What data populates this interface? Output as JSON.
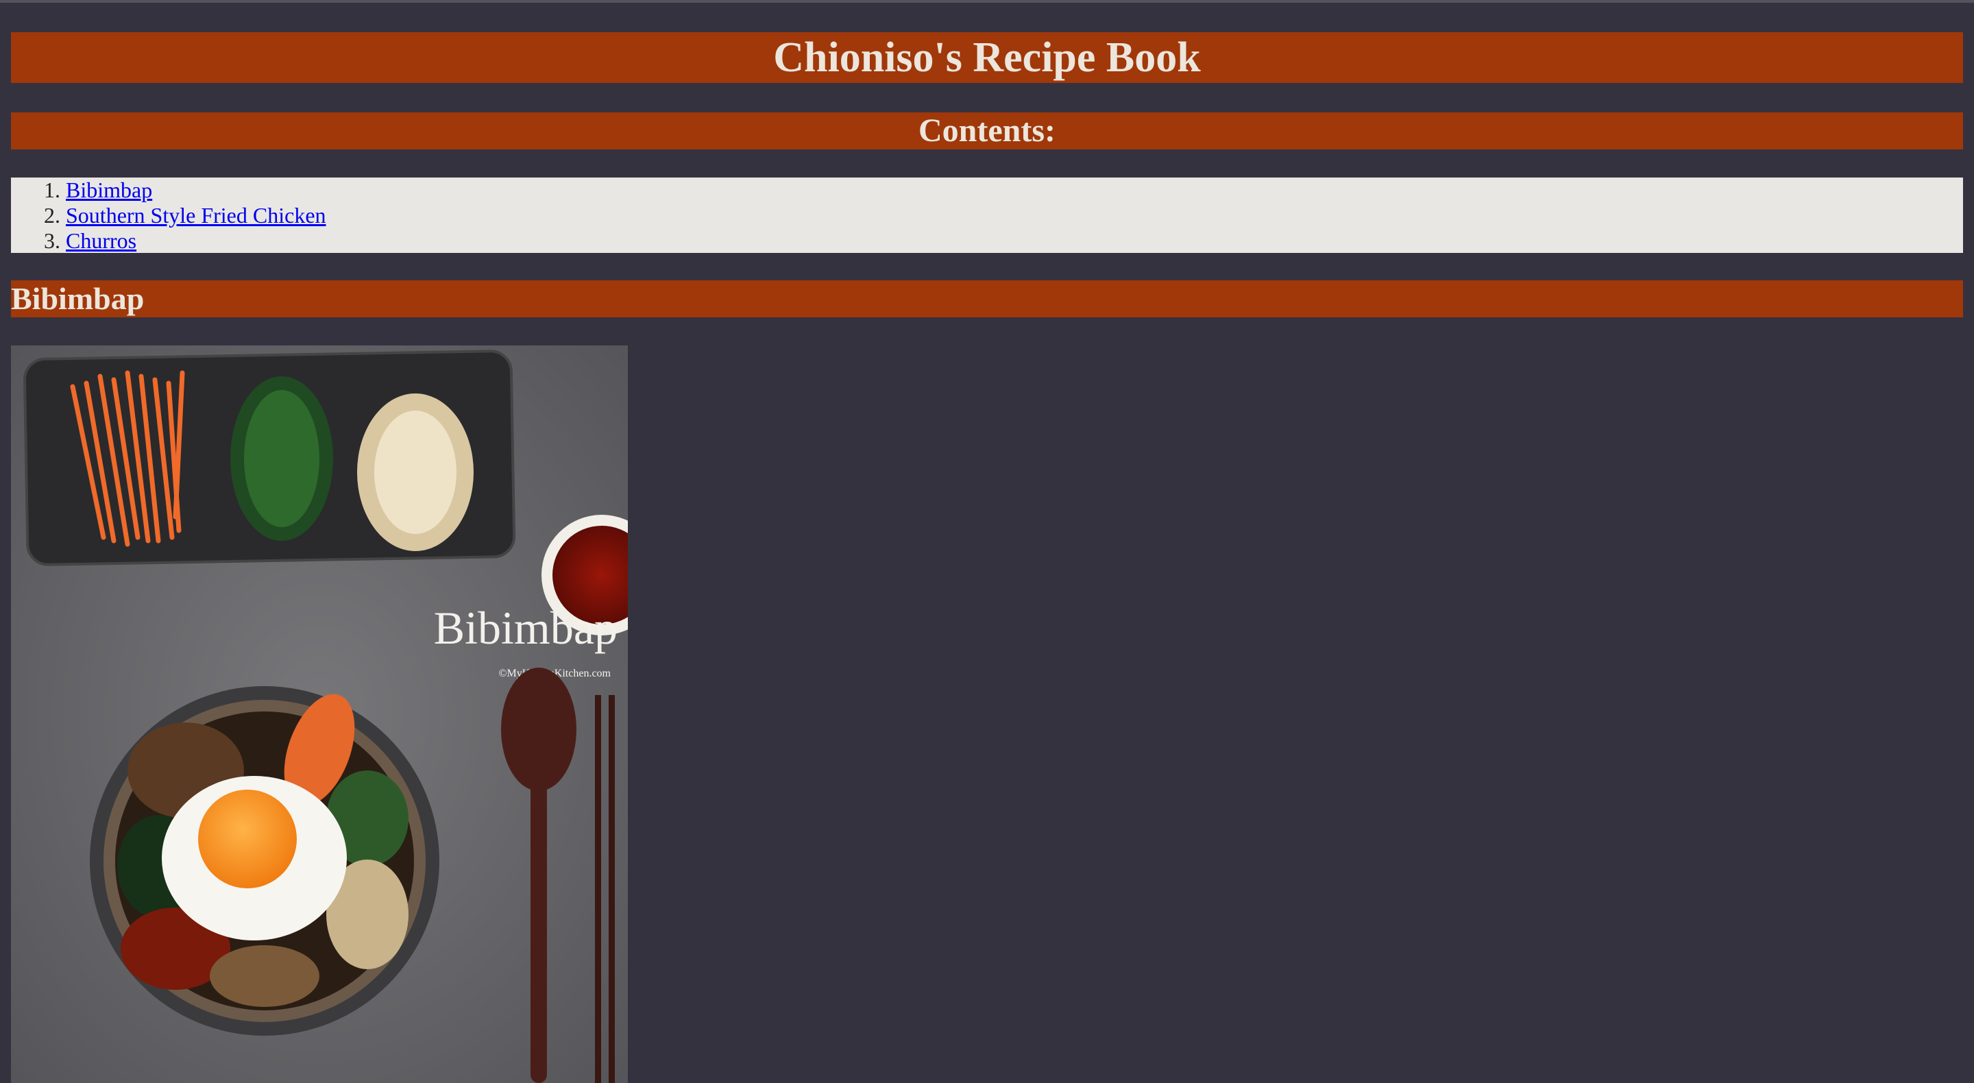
{
  "page": {
    "title": "Chioniso's Recipe Book",
    "contents_heading": "Contents:"
  },
  "toc": {
    "items": [
      {
        "label": "Bibimbap"
      },
      {
        "label": "Southern Style Fried Chicken"
      },
      {
        "label": "Churros"
      }
    ]
  },
  "sections": [
    {
      "heading": "Bibimbap",
      "image": {
        "overlay_title": "Bibimbap",
        "watermark": "©MyKoreanKitchen.com"
      }
    }
  ],
  "colors": {
    "background": "#35323f",
    "header_bar": "#a1380a",
    "header_text": "#ece6dc",
    "toc_background": "#e8e7e3",
    "link": "#0000ee"
  }
}
